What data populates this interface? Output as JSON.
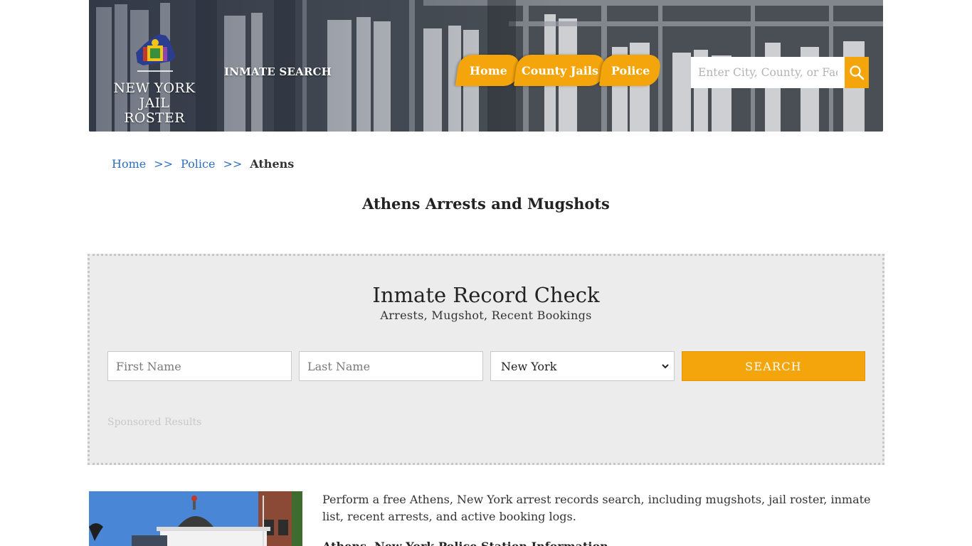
{
  "header": {
    "logo_line1": "NEW YORK",
    "logo_line2": "JAIL ROSTER",
    "inmate_search_label": "INMATE SEARCH",
    "nav": {
      "home": "Home",
      "county_jails": "County Jails",
      "police": "Police"
    },
    "search_placeholder": "Enter City, County, or Facility"
  },
  "breadcrumb": {
    "home": "Home",
    "separator": ">>",
    "police": "Police",
    "current": "Athens"
  },
  "page_title": "Athens Arrests and Mugshots",
  "record_check": {
    "title": "Inmate Record Check",
    "subtitle": "Arrests, Mugshot, Recent Bookings",
    "first_name_placeholder": "First Name",
    "last_name_placeholder": "Last Name",
    "state_selected": "New York",
    "submit_label": "SEARCH",
    "sponsored_label": "Sponsored Results"
  },
  "content": {
    "intro": "Perform a free Athens, New York arrest records search, including mugshots, jail roster, inmate list, recent arrests, and active booking logs.",
    "section_heading": "Athens, New York Police Station Information"
  },
  "colors": {
    "accent": "#f5a50c",
    "link": "#2e6fc1",
    "panel_bg": "#ececec"
  },
  "icons": {
    "search": "magnifier-icon",
    "select": "chevron-down-icon"
  }
}
